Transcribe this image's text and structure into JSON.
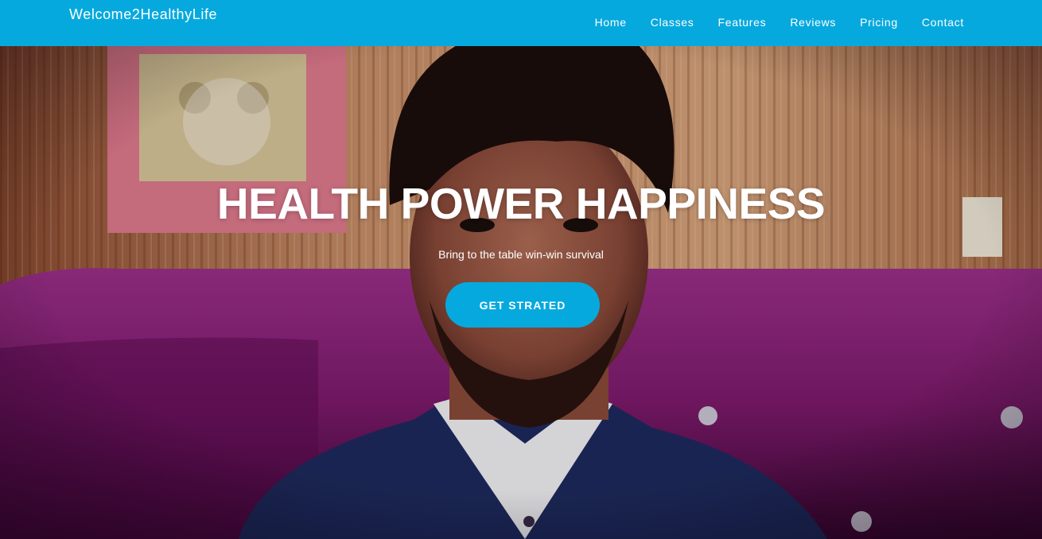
{
  "navbar": {
    "brand": "Welcome2HealthyLife",
    "links": [
      "Home",
      "Classes",
      "Features",
      "Reviews",
      "Pricing",
      "Contact"
    ]
  },
  "hero": {
    "title": "HEALTH POWER HAPPINESS",
    "subtitle": "Bring to the table win-win survival",
    "cta_label": "GET STRATED"
  },
  "colors": {
    "accent": "#06a9de",
    "text": "#ffffff"
  }
}
